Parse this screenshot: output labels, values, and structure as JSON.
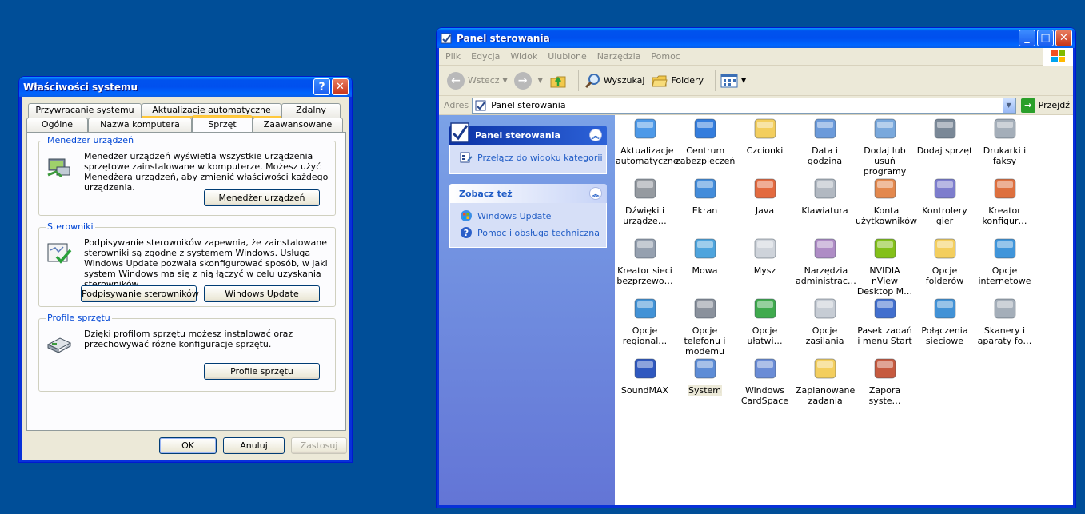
{
  "desktop": {
    "background": "#004e98"
  },
  "sysprops": {
    "title": "Właściwości systemu",
    "tabs_back": [
      "Przywracanie systemu",
      "Aktualizacje automatyczne",
      "Zdalny"
    ],
    "tabs_front": [
      "Ogólne",
      "Nazwa komputera",
      "Sprzęt",
      "Zaawansowane"
    ],
    "active_tab": "Sprzęt",
    "groups": {
      "device_manager": {
        "title": "Menedżer urządzeń",
        "text": "Menedżer urządzeń wyświetla wszystkie urządzenia sprzętowe zainstalowane w komputerze. Możesz użyć Menedżera urządzeń, aby zmienić właściwości każdego urządzenia.",
        "button": "Menedżer urządzeń"
      },
      "drivers": {
        "title": "Sterowniki",
        "text": "Podpisywanie sterowników zapewnia, że zainstalowane sterowniki są zgodne z systemem Windows. Usługa Windows Update pozwala skonfigurować sposób, w jaki system Windows ma się z nią łączyć w celu uzyskania sterowników.",
        "button1": "Podpisywanie sterowników",
        "button2": "Windows Update"
      },
      "profiles": {
        "title": "Profile sprzętu",
        "text": "Dzięki profilom sprzętu możesz instalować oraz przechowywać różne konfiguracje sprzętu.",
        "button": "Profile sprzętu"
      }
    },
    "buttons": {
      "ok": "OK",
      "cancel": "Anuluj",
      "apply": "Zastosuj"
    }
  },
  "cpanel": {
    "title": "Panel sterowania",
    "menu": [
      "Plik",
      "Edycja",
      "Widok",
      "Ulubione",
      "Narzędzia",
      "Pomoc"
    ],
    "toolbar": {
      "back": "Wstecz",
      "search": "Wyszukaj",
      "folders": "Foldery"
    },
    "address": {
      "label": "Adres",
      "value": "Panel sterowania",
      "go": "Przejdź"
    },
    "taskpane": {
      "panel_title": "Panel sterowania",
      "panel_link": "Przełącz do widoku kategorii",
      "see_also_title": "Zobacz też",
      "see_also_links": [
        "Windows Update",
        "Pomoc i obsługa techniczna"
      ]
    },
    "icons": [
      {
        "label": "Aktualizacje automatyczne",
        "icon": "windows-update-icon",
        "color": "#3a8ee6"
      },
      {
        "label": "Centrum zabezpieczeń",
        "icon": "shield-icon",
        "color": "#1e6fd9"
      },
      {
        "label": "Czcionki",
        "icon": "fonts-folder-icon",
        "color": "#f2c94c"
      },
      {
        "label": "Data i godzina",
        "icon": "clock-icon",
        "color": "#5b8fd6"
      },
      {
        "label": "Dodaj lub usuń programy",
        "icon": "add-remove-icon",
        "color": "#6a9fd8"
      },
      {
        "label": "Dodaj sprzęt",
        "icon": "add-hardware-icon",
        "color": "#6b7b8c"
      },
      {
        "label": "Drukarki i faksy",
        "icon": "printer-icon",
        "color": "#9aa5b1"
      },
      {
        "label": "Dźwięki i urządze…",
        "icon": "speaker-icon",
        "color": "#8a8f96"
      },
      {
        "label": "Ekran",
        "icon": "display-icon",
        "color": "#2f7fd6"
      },
      {
        "label": "Java",
        "icon": "java-icon",
        "color": "#e05a2a"
      },
      {
        "label": "Klawiatura",
        "icon": "keyboard-icon",
        "color": "#a8b0ba"
      },
      {
        "label": "Konta użytkowników",
        "icon": "users-icon",
        "color": "#e07b3a"
      },
      {
        "label": "Kontrolery gier",
        "icon": "gamepad-icon",
        "color": "#6f6fc8"
      },
      {
        "label": "Kreator konfigur…",
        "icon": "house-icon",
        "color": "#d9602a"
      },
      {
        "label": "Kreator sieci bezprzewo…",
        "icon": "wireless-icon",
        "color": "#8a96a6"
      },
      {
        "label": "Mowa",
        "icon": "speech-icon",
        "color": "#3b9ad9"
      },
      {
        "label": "Mysz",
        "icon": "mouse-icon",
        "color": "#c9ced6"
      },
      {
        "label": "Narzędzia administrac…",
        "icon": "admin-tools-icon",
        "color": "#a57fbf"
      },
      {
        "label": "NVIDIA nView Desktop M…",
        "icon": "nvidia-icon",
        "color": "#76b900"
      },
      {
        "label": "Opcje folderów",
        "icon": "folder-options-icon",
        "color": "#f2c94c"
      },
      {
        "label": "Opcje internetowe",
        "icon": "internet-options-icon",
        "color": "#2b8ad6"
      },
      {
        "label": "Opcje regional…",
        "icon": "globe-icon",
        "color": "#2e86d1"
      },
      {
        "label": "Opcje telefonu i modemu",
        "icon": "phone-icon",
        "color": "#7d8591"
      },
      {
        "label": "Opcje ułatwi…",
        "icon": "accessibility-icon",
        "color": "#2aa13a"
      },
      {
        "label": "Opcje zasilania",
        "icon": "power-icon",
        "color": "#c0c6cf"
      },
      {
        "label": "Pasek zadań i menu Start",
        "icon": "taskbar-icon",
        "color": "#2d5fc9"
      },
      {
        "label": "Połączenia sieciowe",
        "icon": "network-icon",
        "color": "#2e86d1"
      },
      {
        "label": "Skanery i aparaty fo…",
        "icon": "scanner-icon",
        "color": "#9aa5b1"
      },
      {
        "label": "SoundMAX",
        "icon": "soundmax-icon",
        "color": "#1846b8"
      },
      {
        "label": "System",
        "icon": "system-icon",
        "color": "#4b7fd1"
      },
      {
        "label": "Windows CardSpace",
        "icon": "cardspace-icon",
        "color": "#5a7fd1"
      },
      {
        "label": "Zaplanowane zadania",
        "icon": "scheduled-tasks-icon",
        "color": "#f2c94c"
      },
      {
        "label": "Zapora syste…",
        "icon": "firewall-icon",
        "color": "#c0482a"
      }
    ],
    "selected_icon": "System"
  }
}
